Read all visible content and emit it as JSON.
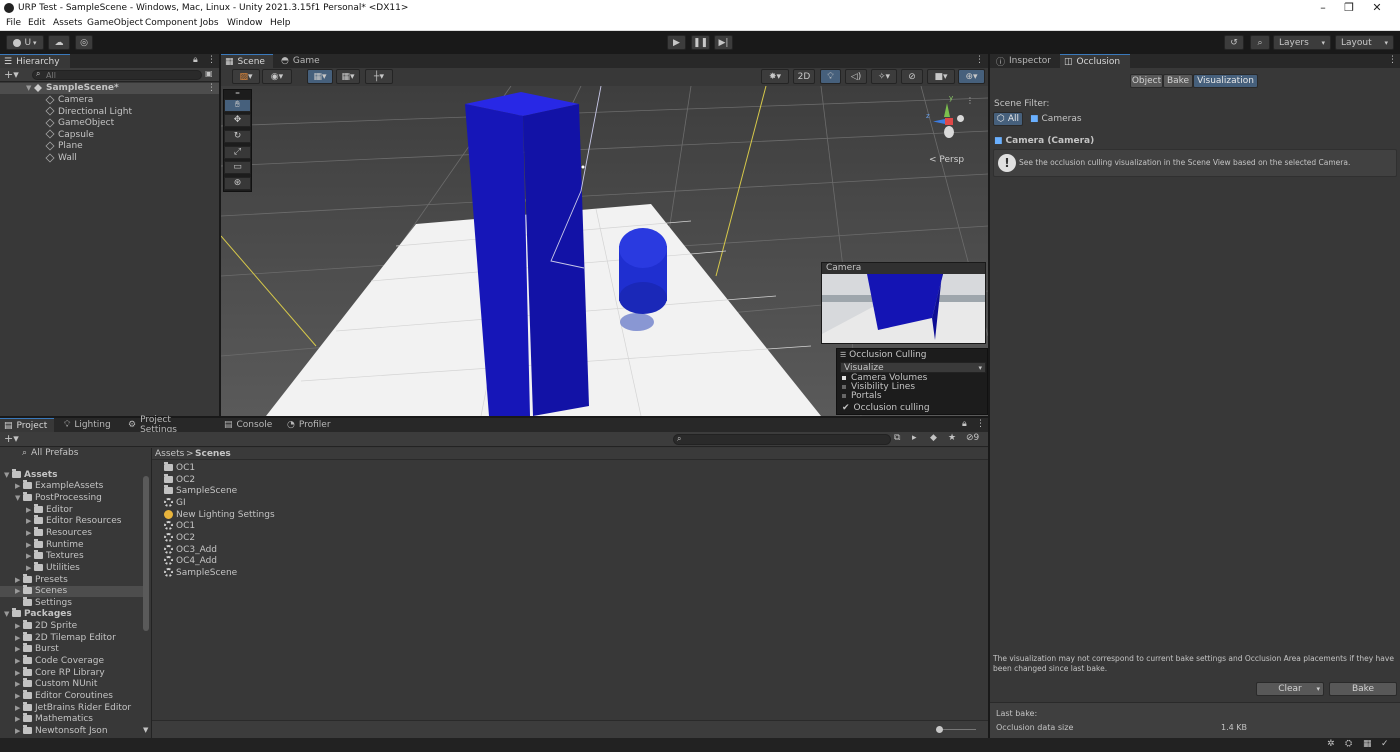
{
  "window": {
    "title": "URP Test - SampleScene - Windows, Mac, Linux - Unity 2021.3.15f1 Personal* <DX11>"
  },
  "menu": [
    "File",
    "Edit",
    "Assets",
    "GameObject",
    "Component",
    "Jobs",
    "Window",
    "Help"
  ],
  "toolbar": {
    "account_label": "U",
    "layers_label": "Layers",
    "layout_label": "Layout"
  },
  "hierarchy": {
    "tab_label": "Hierarchy",
    "search_placeholder": "All",
    "scene_name": "SampleScene*",
    "items": [
      "Camera",
      "Directional Light",
      "GameObject",
      "Capsule",
      "Plane",
      "Wall"
    ]
  },
  "scene": {
    "tabs": [
      "Scene",
      "Game"
    ],
    "mode_2d_label": "2D",
    "persp_label": "< Persp",
    "gizmo_axes": {
      "y": "y",
      "z": "z"
    },
    "camera_preview_title": "Camera",
    "occlusion_overlay": {
      "title": "Occlusion Culling",
      "dropdown_value": "Visualize",
      "options": [
        "Camera Volumes",
        "Visibility Lines",
        "Portals"
      ],
      "checkbox_label": "Occlusion culling",
      "checked": true
    }
  },
  "bottom": {
    "tabs": [
      "Project",
      "Lighting",
      "Project Settings",
      "Console",
      "Profiler"
    ],
    "search_count": "9",
    "breadcrumb": {
      "root": "Assets",
      "sep": ">",
      "current": "Scenes"
    },
    "tree": [
      {
        "label": "All Prefabs",
        "indent": 0,
        "kind": "search"
      },
      {
        "label": "Assets",
        "indent": 0,
        "kind": "folder",
        "bold": true,
        "open": true
      },
      {
        "label": "ExampleAssets",
        "indent": 1,
        "kind": "folder"
      },
      {
        "label": "PostProcessing",
        "indent": 1,
        "kind": "folder",
        "open": true
      },
      {
        "label": "Editor",
        "indent": 2,
        "kind": "folder"
      },
      {
        "label": "Editor Resources",
        "indent": 2,
        "kind": "folder"
      },
      {
        "label": "Resources",
        "indent": 2,
        "kind": "folder"
      },
      {
        "label": "Runtime",
        "indent": 2,
        "kind": "folder"
      },
      {
        "label": "Textures",
        "indent": 2,
        "kind": "folder"
      },
      {
        "label": "Utilities",
        "indent": 2,
        "kind": "folder"
      },
      {
        "label": "Presets",
        "indent": 1,
        "kind": "folder"
      },
      {
        "label": "Scenes",
        "indent": 1,
        "kind": "folder",
        "selected": true
      },
      {
        "label": "Settings",
        "indent": 1,
        "kind": "folder",
        "noarrow": true
      },
      {
        "label": "Packages",
        "indent": 0,
        "kind": "folder",
        "bold": true,
        "open": true
      },
      {
        "label": "2D Sprite",
        "indent": 1,
        "kind": "folder"
      },
      {
        "label": "2D Tilemap Editor",
        "indent": 1,
        "kind": "folder"
      },
      {
        "label": "Burst",
        "indent": 1,
        "kind": "folder"
      },
      {
        "label": "Code Coverage",
        "indent": 1,
        "kind": "folder"
      },
      {
        "label": "Core RP Library",
        "indent": 1,
        "kind": "folder"
      },
      {
        "label": "Custom NUnit",
        "indent": 1,
        "kind": "folder"
      },
      {
        "label": "Editor Coroutines",
        "indent": 1,
        "kind": "folder"
      },
      {
        "label": "JetBrains Rider Editor",
        "indent": 1,
        "kind": "folder"
      },
      {
        "label": "Mathematics",
        "indent": 1,
        "kind": "folder"
      },
      {
        "label": "Newtonsoft Json",
        "indent": 1,
        "kind": "folder"
      }
    ],
    "files": [
      {
        "label": "OC1",
        "kind": "folder"
      },
      {
        "label": "OC2",
        "kind": "folder"
      },
      {
        "label": "SampleScene",
        "kind": "folder"
      },
      {
        "label": "GI",
        "kind": "scene"
      },
      {
        "label": "New Lighting Settings",
        "kind": "lighting"
      },
      {
        "label": "OC1",
        "kind": "scene"
      },
      {
        "label": "OC2",
        "kind": "scene"
      },
      {
        "label": "OC3_Add",
        "kind": "scene"
      },
      {
        "label": "OC4_Add",
        "kind": "scene"
      },
      {
        "label": "SampleScene",
        "kind": "scene"
      }
    ]
  },
  "right": {
    "tabs": [
      "Inspector",
      "Occlusion"
    ],
    "mode_buttons": [
      "Object",
      "Bake",
      "Visualization"
    ],
    "scene_filter_label": "Scene Filter:",
    "filter_all": "All",
    "filter_cameras": "Cameras",
    "camera_heading": "Camera (Camera)",
    "info_text": "See the occlusion culling visualization in the Scene View based on the selected Camera.",
    "warning_text": "The visualization may not correspond to current bake settings and Occlusion Area placements if they have been changed since last bake.",
    "clear_label": "Clear",
    "bake_label": "Bake",
    "last_bake_label": "Last bake:",
    "occlusion_size_label": "Occlusion data size",
    "occlusion_size_value": "1.4 KB"
  },
  "colors": {
    "accent": "#3a79bb",
    "wall": "#1414b4",
    "capsule": "#1f2fd0",
    "scene_bg": "#595959"
  }
}
